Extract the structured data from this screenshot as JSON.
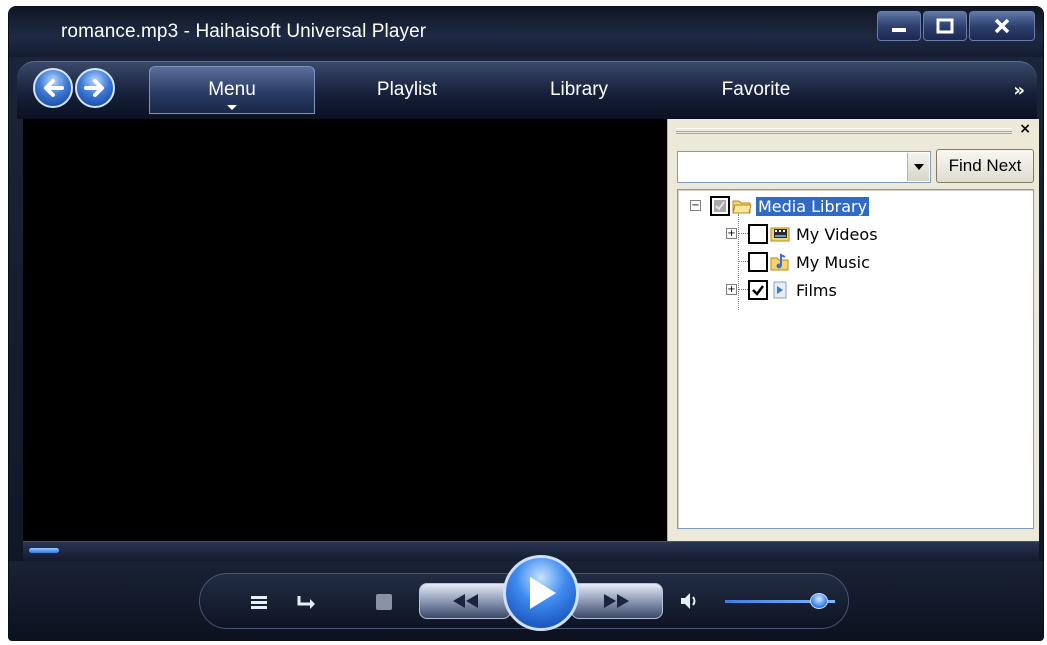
{
  "window": {
    "title": "romance.mp3 - Haihaisoft Universal Player",
    "controls": [
      "minimize-icon",
      "maximize-icon",
      "close-icon"
    ]
  },
  "nav": {
    "back_icon": "arrow-left-icon",
    "forward_icon": "arrow-right-icon",
    "tabs": [
      {
        "label": "Menu",
        "active": true
      },
      {
        "label": "Playlist",
        "active": false
      },
      {
        "label": "Library",
        "active": false
      },
      {
        "label": "Favorite",
        "active": false
      }
    ],
    "more": "»"
  },
  "library_panel": {
    "close": "×",
    "search": {
      "value": "",
      "placeholder": ""
    },
    "find_button": "Find Next",
    "tree": [
      {
        "label": "Media Library",
        "checked": "grey",
        "selected": true,
        "expanded": true,
        "icon": "folder-open-icon"
      },
      {
        "label": "My Videos",
        "checked": false,
        "selected": false,
        "expandable": true,
        "icon": "video-folder-icon"
      },
      {
        "label": "My Music",
        "checked": false,
        "selected": false,
        "expandable": false,
        "icon": "music-folder-icon"
      },
      {
        "label": "Films",
        "checked": true,
        "selected": false,
        "expandable": true,
        "icon": "film-icon"
      }
    ]
  },
  "player": {
    "seek_progress": 0.03,
    "volume": 0.85,
    "buttons": [
      "playlist-icon",
      "repeat-icon",
      "stop-icon",
      "rewind-icon",
      "play-icon",
      "fast-forward-icon",
      "volume-icon"
    ]
  },
  "colors": {
    "accent": "#3f8bf0",
    "selection": "#316ac5",
    "panel_bg": "#ece9d8"
  }
}
